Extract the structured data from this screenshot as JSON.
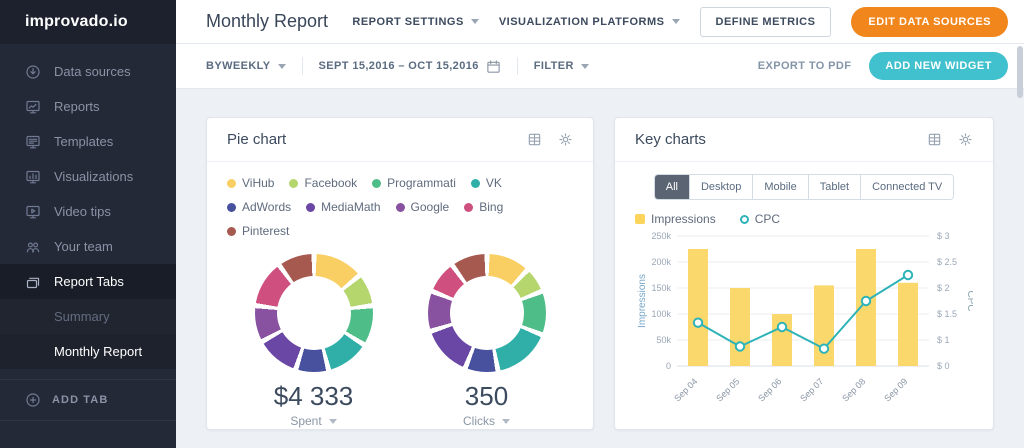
{
  "app": {
    "logo": "improvado.io"
  },
  "sidebar": {
    "items": [
      {
        "label": "Data sources",
        "icon": "data-sources-icon",
        "active": false
      },
      {
        "label": "Reports",
        "icon": "reports-icon",
        "active": false
      },
      {
        "label": "Templates",
        "icon": "templates-icon",
        "active": false
      },
      {
        "label": "Visualizations",
        "icon": "visualizations-icon",
        "active": false
      },
      {
        "label": "Video tips",
        "icon": "video-tips-icon",
        "active": false
      },
      {
        "label": "Your team",
        "icon": "team-icon",
        "active": false
      },
      {
        "label": "Report Tabs",
        "icon": "report-tabs-icon",
        "active": true
      }
    ],
    "subitems": [
      {
        "label": "Summary",
        "active": false
      },
      {
        "label": "Monthly Report",
        "active": true
      }
    ],
    "add_tab_label": "ADD TAB"
  },
  "header": {
    "title": "Monthly Report",
    "menus": [
      {
        "label": "REPORT SETTINGS"
      },
      {
        "label": "VISUALIZATION PLATFORMS"
      }
    ],
    "define_metrics_label": "DEFINE METRICS",
    "edit_data_sources_label": "EDIT DATA SOURCES"
  },
  "toolbar": {
    "interval_label": "BYWEEKLY",
    "date_range": "SEPT 15,2016 – OCT 15,2016",
    "filter_label": "FILTER",
    "export_label": "EXPORT TO PDF",
    "add_widget_label": "ADD NEW WIDGET"
  },
  "pie_card": {
    "title": "Pie chart"
  },
  "key_card": {
    "title": "Key charts",
    "tabs": [
      {
        "label": "All",
        "active": true
      },
      {
        "label": "Desktop",
        "active": false
      },
      {
        "label": "Mobile",
        "active": false
      },
      {
        "label": "Tablet",
        "active": false
      },
      {
        "label": "Connected TV",
        "active": false
      }
    ]
  },
  "colors": {
    "accent_orange": "#f0861c",
    "accent_teal": "#41c0cd",
    "bar_color": "#fbd45c",
    "line_color": "#2db3b8"
  },
  "chart_data": [
    {
      "type": "pie",
      "name": "spent-donut",
      "center_value": "$4 333",
      "center_label": "Spent",
      "labels": [
        "ViHub",
        "Facebook",
        "Programmati",
        "VK",
        "AdWords",
        "MediaMath",
        "Google",
        "Bing",
        "Pinterest"
      ],
      "values": [
        14,
        9,
        11,
        12,
        9,
        12,
        10,
        13,
        10
      ],
      "colors": [
        "#f9cf63",
        "#b5d66d",
        "#4fbd88",
        "#2fafa8",
        "#47519e",
        "#6a46a5",
        "#8952a0",
        "#cf4f7f",
        "#a6594f"
      ]
    },
    {
      "type": "pie",
      "name": "clicks-donut",
      "center_value": "350",
      "center_label": "Clicks",
      "labels": [
        "ViHub",
        "Facebook",
        "Programmati",
        "VK",
        "AdWords",
        "MediaMath",
        "Google",
        "Bing",
        "Pinterest"
      ],
      "values": [
        12,
        7,
        12,
        16,
        9,
        14,
        11,
        9,
        10
      ],
      "colors": [
        "#f9cf63",
        "#b5d66d",
        "#4fbd88",
        "#2fafa8",
        "#47519e",
        "#6a46a5",
        "#8952a0",
        "#cf4f7f",
        "#a6594f"
      ]
    },
    {
      "type": "combo",
      "name": "impressions-cpc",
      "categories": [
        "Sep 04",
        "Sep 05",
        "Sep 06",
        "Sep 07",
        "Sep 08",
        "Sep 09"
      ],
      "series": [
        {
          "name": "Impressions",
          "type": "bar",
          "color": "#fbd45c",
          "axis": "left",
          "values": [
            225000,
            150000,
            100000,
            155000,
            225000,
            160000
          ]
        },
        {
          "name": "CPC",
          "type": "line",
          "color": "#2db3b8",
          "axis": "right",
          "values": [
            1.0,
            0.45,
            0.9,
            0.4,
            1.5,
            2.1
          ]
        }
      ],
      "y_left": {
        "label": "Impressions",
        "max": 250000,
        "ticks": [
          "0",
          "50k",
          "100k",
          "150k",
          "200k",
          "250k"
        ]
      },
      "y_right": {
        "label": "CPC",
        "max": 3,
        "ticks": [
          "$ 0",
          "$ 1",
          "$ 1.5",
          "$ 2",
          "$ 2.5",
          "$ 3"
        ]
      },
      "grid": true,
      "legend_position": "top-left"
    }
  ]
}
